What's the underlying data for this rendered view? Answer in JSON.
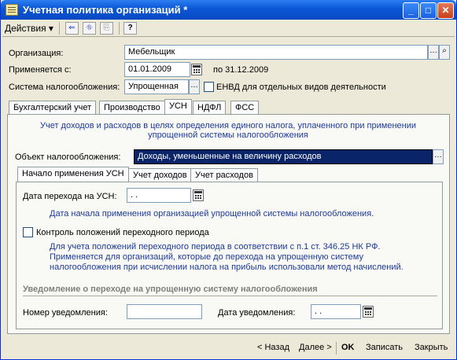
{
  "window": {
    "title": "Учетная политика организаций *"
  },
  "toolbar": {
    "actions_label": "Действия"
  },
  "form": {
    "org_label": "Организация:",
    "org_value": "Мебельщик",
    "applied_label": "Применяется с:",
    "applied_date": "01.01.2009",
    "applied_to": "по 31.12.2009",
    "tax_system_label": "Система налогообложения:",
    "tax_system_value": "Упрощенная",
    "envd_label": "ЕНВД для отдельных видов деятельности"
  },
  "tabs": [
    "Бухгалтерский учет",
    "Производство",
    "УСН",
    "НДФЛ",
    "ФСС"
  ],
  "usn": {
    "heading": "Учет доходов и расходов в целях определения единого налога, уплаченного при применении упрощенной системы налогообложения",
    "object_label": "Объект налогообложения:",
    "object_value": "Доходы, уменьшенные на величину расходов"
  },
  "subtabs": [
    "Начало применения УСН",
    "Учет доходов",
    "Учет расходов"
  ],
  "start": {
    "transition_label": "Дата перехода на УСН:",
    "transition_value": " .  .",
    "transition_hint": "Дата начала применения организацией упрощенной системы налогообложения.",
    "control_label": "Контроль положений переходного периода",
    "control_hint": "Для учета положений переходного периода в соответствии с п.1 ст. 346.25 НК РФ. Применяется для организаций, которые до перехода на упрощенную систему налогообложения при исчислении налога на прибыль использовали метод начислений.",
    "notice_heading": "Уведомление о переходе на упрощенную систему налогообложения",
    "notice_number_label": "Номер уведомления:",
    "notice_number_value": "",
    "notice_date_label": "Дата уведомления:",
    "notice_date_value": " .  ."
  },
  "bottom": {
    "back": "< Назад",
    "next": "Далее >",
    "ok": "OK",
    "save": "Записать",
    "close": "Закрыть"
  }
}
